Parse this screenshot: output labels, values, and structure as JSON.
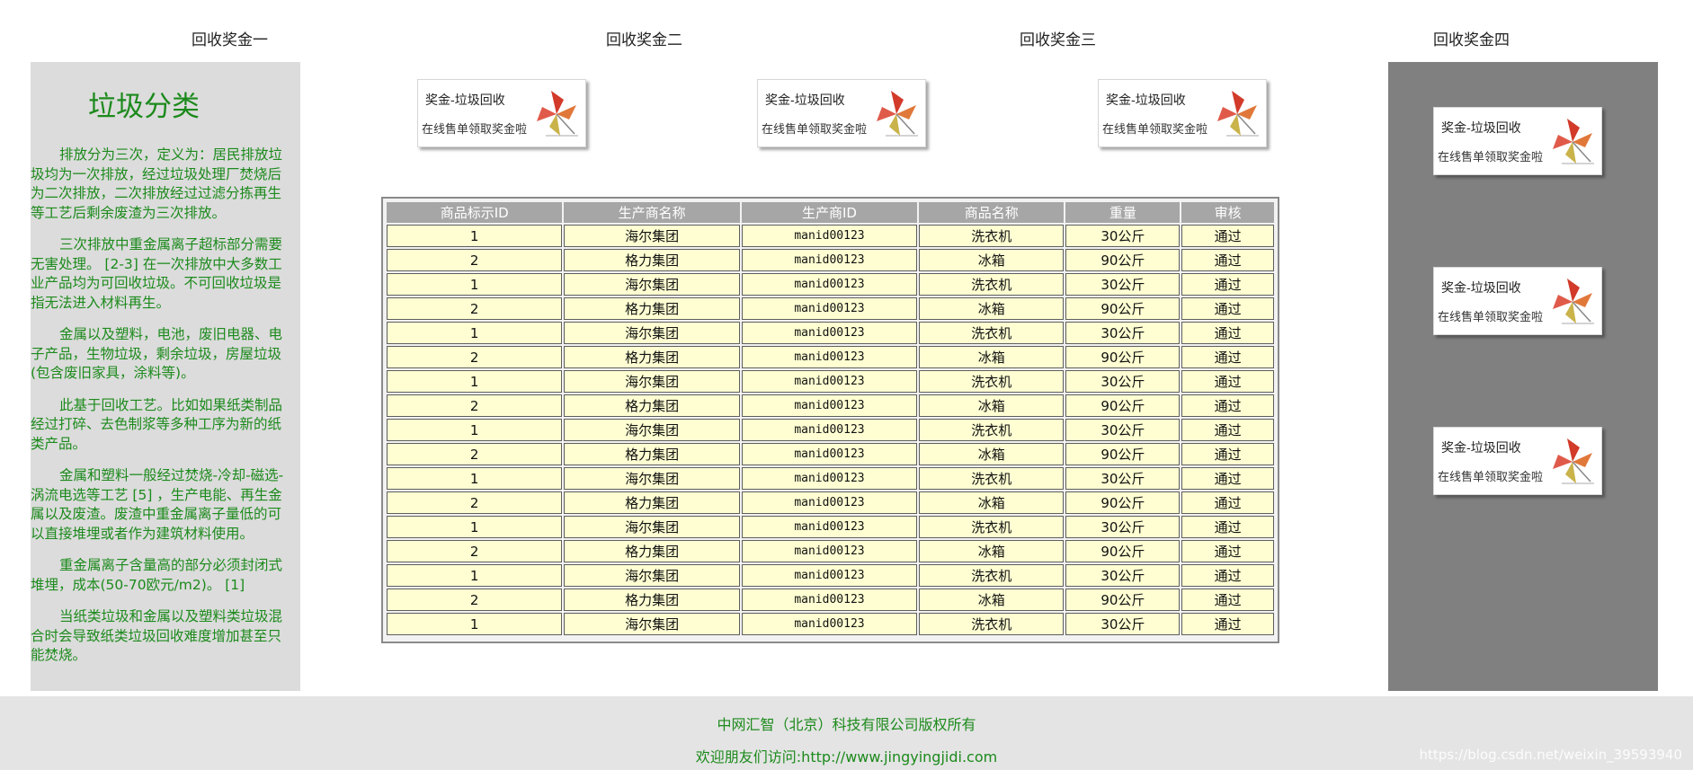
{
  "tabs": [
    "回收奖金一",
    "回收奖金二",
    "回收奖金三",
    "回收奖金四"
  ],
  "left_panel": {
    "title": "垃圾分类",
    "paragraphs": [
      "排放分为三次，定义为：居民排放垃圾均为一次排放，经过垃圾处理厂焚烧后为二次排放，二次排放经过过滤分拣再生等工艺后剩余废渣为三次排放。",
      "三次排放中重金属离子超标部分需要无害处理。 [2-3] 在一次排放中大多数工业产品均为可回收垃圾。不可回收垃圾是指无法进入材料再生。",
      "金属以及塑料，电池，废旧电器、电子产品，生物垃圾，剩余垃圾，房屋垃圾(包含废旧家具，涂料等)。",
      "此基于回收工艺。比如如果纸类制品经过打碎、去色制浆等多种工序为新的纸类产品。",
      "金属和塑料一般经过焚烧-冷却-磁选-涡流电选等工艺 [5] ，生产电能、再生金属以及废渣。废渣中重金属离子量低的可以直接堆埋或者作为建筑材料使用。",
      "重金属离子含量高的部分必须封闭式堆埋，成本(50-70欧元/m2)。 [1]",
      "当纸类垃圾和金属以及塑料类垃圾混合时会导致纸类垃圾回收难度增加甚至只能焚烧。"
    ]
  },
  "banner": {
    "title": "奖金-垃圾回收",
    "subtitle": "在线售单领取奖金啦",
    "icon": "pinwheel-icon"
  },
  "table": {
    "headers": [
      "商品标示ID",
      "生产商名称",
      "生产商ID",
      "商品名称",
      "重量",
      "审核"
    ],
    "rows": [
      [
        "1",
        "海尔集团",
        "manid00123",
        "洗衣机",
        "30公斤",
        "通过"
      ],
      [
        "2",
        "格力集团",
        "manid00123",
        "冰箱",
        "90公斤",
        "通过"
      ],
      [
        "1",
        "海尔集团",
        "manid00123",
        "洗衣机",
        "30公斤",
        "通过"
      ],
      [
        "2",
        "格力集团",
        "manid00123",
        "冰箱",
        "90公斤",
        "通过"
      ],
      [
        "1",
        "海尔集团",
        "manid00123",
        "洗衣机",
        "30公斤",
        "通过"
      ],
      [
        "2",
        "格力集团",
        "manid00123",
        "冰箱",
        "90公斤",
        "通过"
      ],
      [
        "1",
        "海尔集团",
        "manid00123",
        "洗衣机",
        "30公斤",
        "通过"
      ],
      [
        "2",
        "格力集团",
        "manid00123",
        "冰箱",
        "90公斤",
        "通过"
      ],
      [
        "1",
        "海尔集团",
        "manid00123",
        "洗衣机",
        "30公斤",
        "通过"
      ],
      [
        "2",
        "格力集团",
        "manid00123",
        "冰箱",
        "90公斤",
        "通过"
      ],
      [
        "1",
        "海尔集团",
        "manid00123",
        "洗衣机",
        "30公斤",
        "通过"
      ],
      [
        "2",
        "格力集团",
        "manid00123",
        "冰箱",
        "90公斤",
        "通过"
      ],
      [
        "1",
        "海尔集团",
        "manid00123",
        "洗衣机",
        "30公斤",
        "通过"
      ],
      [
        "2",
        "格力集团",
        "manid00123",
        "冰箱",
        "90公斤",
        "通过"
      ],
      [
        "1",
        "海尔集团",
        "manid00123",
        "洗衣机",
        "30公斤",
        "通过"
      ],
      [
        "2",
        "格力集团",
        "manid00123",
        "冰箱",
        "90公斤",
        "通过"
      ],
      [
        "1",
        "海尔集团",
        "manid00123",
        "洗衣机",
        "30公斤",
        "通过"
      ]
    ]
  },
  "footer": {
    "copyright": "中网汇智（北京）科技有限公司版权所有",
    "visit": "欢迎朋友们访问:http://www.jingyingjidi.com"
  },
  "watermark": "https://blog.csdn.net/weixin_39593940",
  "colors": {
    "accent_green": "#1c8a1c",
    "panel_gray": "#dcdcdc",
    "sidebar_dark_gray": "#808080",
    "header_gray": "#a6a6a6",
    "cell_yellow": "#fefed2"
  }
}
